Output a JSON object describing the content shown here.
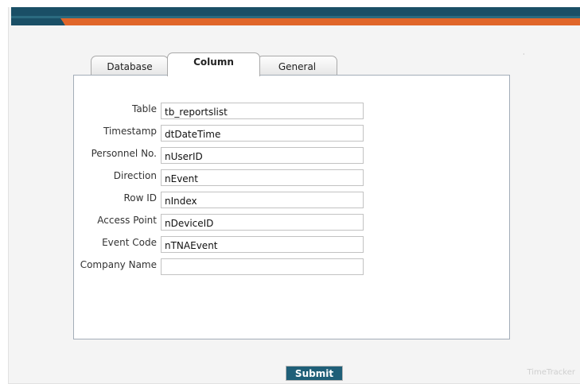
{
  "tabs": [
    {
      "label": "Database",
      "active": false
    },
    {
      "label": "Column",
      "active": true
    },
    {
      "label": "General",
      "active": false
    }
  ],
  "form": {
    "fields": [
      {
        "label": "Table",
        "value": "tb_reportslist"
      },
      {
        "label": "Timestamp",
        "value": "dtDateTime"
      },
      {
        "label": "Personnel No.",
        "value": "nUserID"
      },
      {
        "label": "Direction",
        "value": "nEvent"
      },
      {
        "label": "Row ID",
        "value": "nIndex"
      },
      {
        "label": "Access Point",
        "value": "nDeviceID"
      },
      {
        "label": "Event Code",
        "value": "nTNAEvent"
      },
      {
        "label": "Company Name",
        "value": ""
      }
    ]
  },
  "footer": {
    "submit_label": "Submit",
    "brand": "TimeTracker"
  },
  "colors": {
    "header_teal": "#1a4f66",
    "header_orange": "#e0662a",
    "submit_bg": "#1f5f78"
  }
}
